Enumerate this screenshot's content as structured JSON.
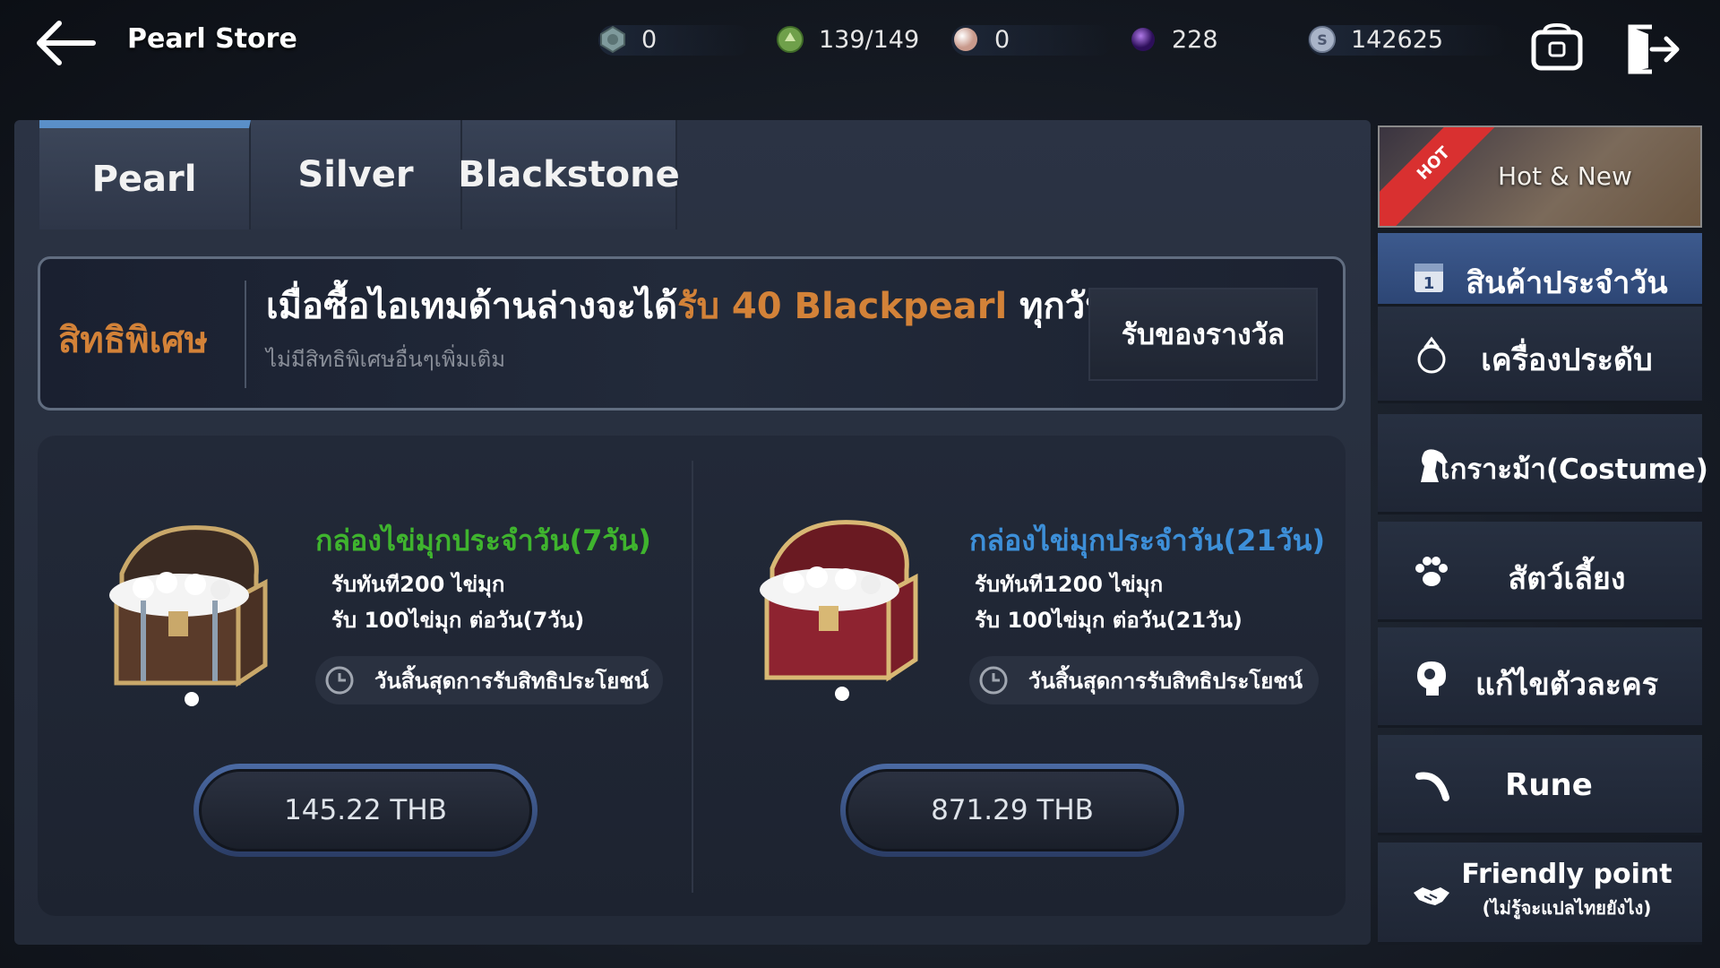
{
  "header": {
    "title": "Pearl Store",
    "currencies": [
      {
        "name": "stone-currency",
        "value": "0",
        "color": "#6b8a8a"
      },
      {
        "name": "energy-currency",
        "value": "139/149",
        "color": "#6fa04a"
      },
      {
        "name": "pearl-currency",
        "value": "0",
        "color": "#e7c9bf"
      },
      {
        "name": "blackstone-currency",
        "value": "228",
        "color": "#5c2d9c"
      },
      {
        "name": "silver-currency",
        "value": "142625",
        "color": "#9aa6c0"
      }
    ]
  },
  "tabs": [
    {
      "label": "Pearl",
      "active": true
    },
    {
      "label": "Silver",
      "active": false
    },
    {
      "label": "Blackstone",
      "active": false
    }
  ],
  "promo": {
    "tag": "สิทธิพิเศษ",
    "head_prefix": "เมื่อซื้อไอเทมด้านล่างจะได้",
    "head_highlight": "รับ 40 Blackpearl",
    "head_suffix": " ทุกวัน",
    "sub": "ไม่มีสิทธิพิเศษอื่นๆเพิ่มเติม",
    "claim_label": "รับของรางวัล"
  },
  "products": [
    {
      "title": "กล่องไข่มุกประจำวัน(7วัน)",
      "title_color": "#3fb42e",
      "line1": "รับทันที200 ไข่มุก",
      "line2": "รับ 100ไข่มุก ต่อวัน(7วัน)",
      "expire": "วันสิ้นสุดการรับสิทธิประโยชน์",
      "price": "145.22 THB",
      "chest_color": "wood"
    },
    {
      "title": "กล่องไข่มุกประจำวัน(21วัน)",
      "title_color": "#3d8fd8",
      "line1": "รับทันที1200 ไข่มุก",
      "line2": "รับ 100ไข่มุก ต่อวัน(21วัน)",
      "expire": "วันสิ้นสุดการรับสิทธิประโยชน์",
      "price": "871.29 THB",
      "chest_color": "red"
    }
  ],
  "sidebar": {
    "hot_badge": "HOT",
    "hot_label": "Hot & New",
    "items": [
      {
        "label": "สินค้าประจำวัน",
        "icon": "calendar-icon",
        "active": true
      },
      {
        "label": "เครื่องประดับ",
        "icon": "ring-icon",
        "active": false
      },
      {
        "label": "เกราะม้า(Costume)",
        "icon": "horse-icon",
        "active": false
      },
      {
        "label": "สัตว์เลี้ยง",
        "icon": "paw-icon",
        "active": false
      },
      {
        "label": "แก้ไขตัวละคร",
        "icon": "head-icon",
        "active": false
      },
      {
        "label": "Rune",
        "icon": "rune-icon",
        "active": false
      },
      {
        "label": "Friendly point",
        "sublabel": "(ไม่รู้จะแปลไทยยังไง)",
        "icon": "handshake-icon",
        "active": false
      }
    ]
  }
}
